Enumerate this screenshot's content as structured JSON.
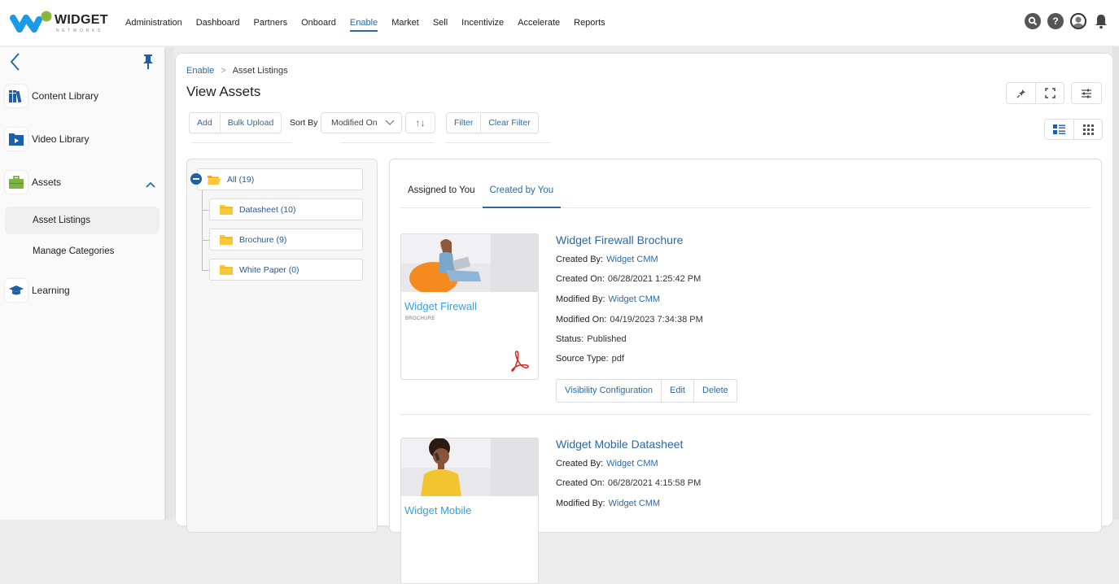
{
  "brand": {
    "name": "WIDGET",
    "sub": "NETWORKS",
    "primary": "#2a6aa8",
    "logo_blue": "#1a9be8",
    "logo_green": "#8bb83a"
  },
  "nav": {
    "items": [
      {
        "label": "Administration",
        "active": false
      },
      {
        "label": "Dashboard",
        "active": false
      },
      {
        "label": "Partners",
        "active": false
      },
      {
        "label": "Onboard",
        "active": false
      },
      {
        "label": "Enable",
        "active": true
      },
      {
        "label": "Market",
        "active": false
      },
      {
        "label": "Sell",
        "active": false
      },
      {
        "label": "Incentivize",
        "active": false
      },
      {
        "label": "Accelerate",
        "active": false
      },
      {
        "label": "Reports",
        "active": false
      }
    ],
    "icons": [
      "search-icon",
      "help-icon",
      "user-avatar-icon",
      "bell-icon"
    ],
    "help_glyph": "?"
  },
  "sidebar": {
    "items": [
      {
        "label": "Content Library",
        "icon": "books-icon"
      },
      {
        "label": "Video Library",
        "icon": "video-folder-icon"
      },
      {
        "label": "Assets",
        "icon": "briefcase-icon",
        "expanded": true
      },
      {
        "label": "Learning",
        "icon": "graduation-cap-icon"
      }
    ],
    "sub_items": [
      {
        "label": "Asset Listings",
        "active": true
      },
      {
        "label": "Manage Categories",
        "active": false
      }
    ]
  },
  "breadcrumb": {
    "parent": "Enable",
    "separator": ">",
    "current": "Asset Listings"
  },
  "page_title": "View Assets",
  "toolbar": {
    "add": "Add",
    "bulk_upload": "Bulk Upload",
    "sort_by_label": "Sort By",
    "sort_value": "Modified On",
    "sort_dir_glyph": "↑↓",
    "filter": "Filter",
    "clear_filter": "Clear Filter"
  },
  "tree": {
    "root": {
      "label": "All (19)"
    },
    "children": [
      {
        "label": "Datasheet (10)"
      },
      {
        "label": "Brochure (9)"
      },
      {
        "label": "White Paper (0)"
      }
    ]
  },
  "tabs": [
    {
      "label": "Assigned to You",
      "active": false
    },
    {
      "label": "Created by You",
      "active": true
    }
  ],
  "labels": {
    "created_by": "Created By:",
    "created_on": "Created On:",
    "modified_by": "Modified By:",
    "modified_on": "Modified On:",
    "status": "Status:",
    "source_type": "Source Type:"
  },
  "assets": [
    {
      "title": "Widget Firewall Brochure",
      "thumb_title": "Widget Firewall",
      "thumb_sub": "BROCHURE",
      "created_by": "Widget CMM",
      "created_on": "06/28/2021 1:25:42 PM",
      "modified_by": "Widget CMM",
      "modified_on": "04/19/2023 7:34:38 PM",
      "status": "Published",
      "source_type": "pdf",
      "actions": [
        "Visibility Configuration",
        "Edit",
        "Delete"
      ]
    },
    {
      "title": "Widget Mobile Datasheet",
      "thumb_title": "Widget Mobile",
      "created_by": "Widget CMM",
      "created_on": "06/28/2021 4:15:58 PM",
      "modified_by": "Widget CMM"
    }
  ]
}
